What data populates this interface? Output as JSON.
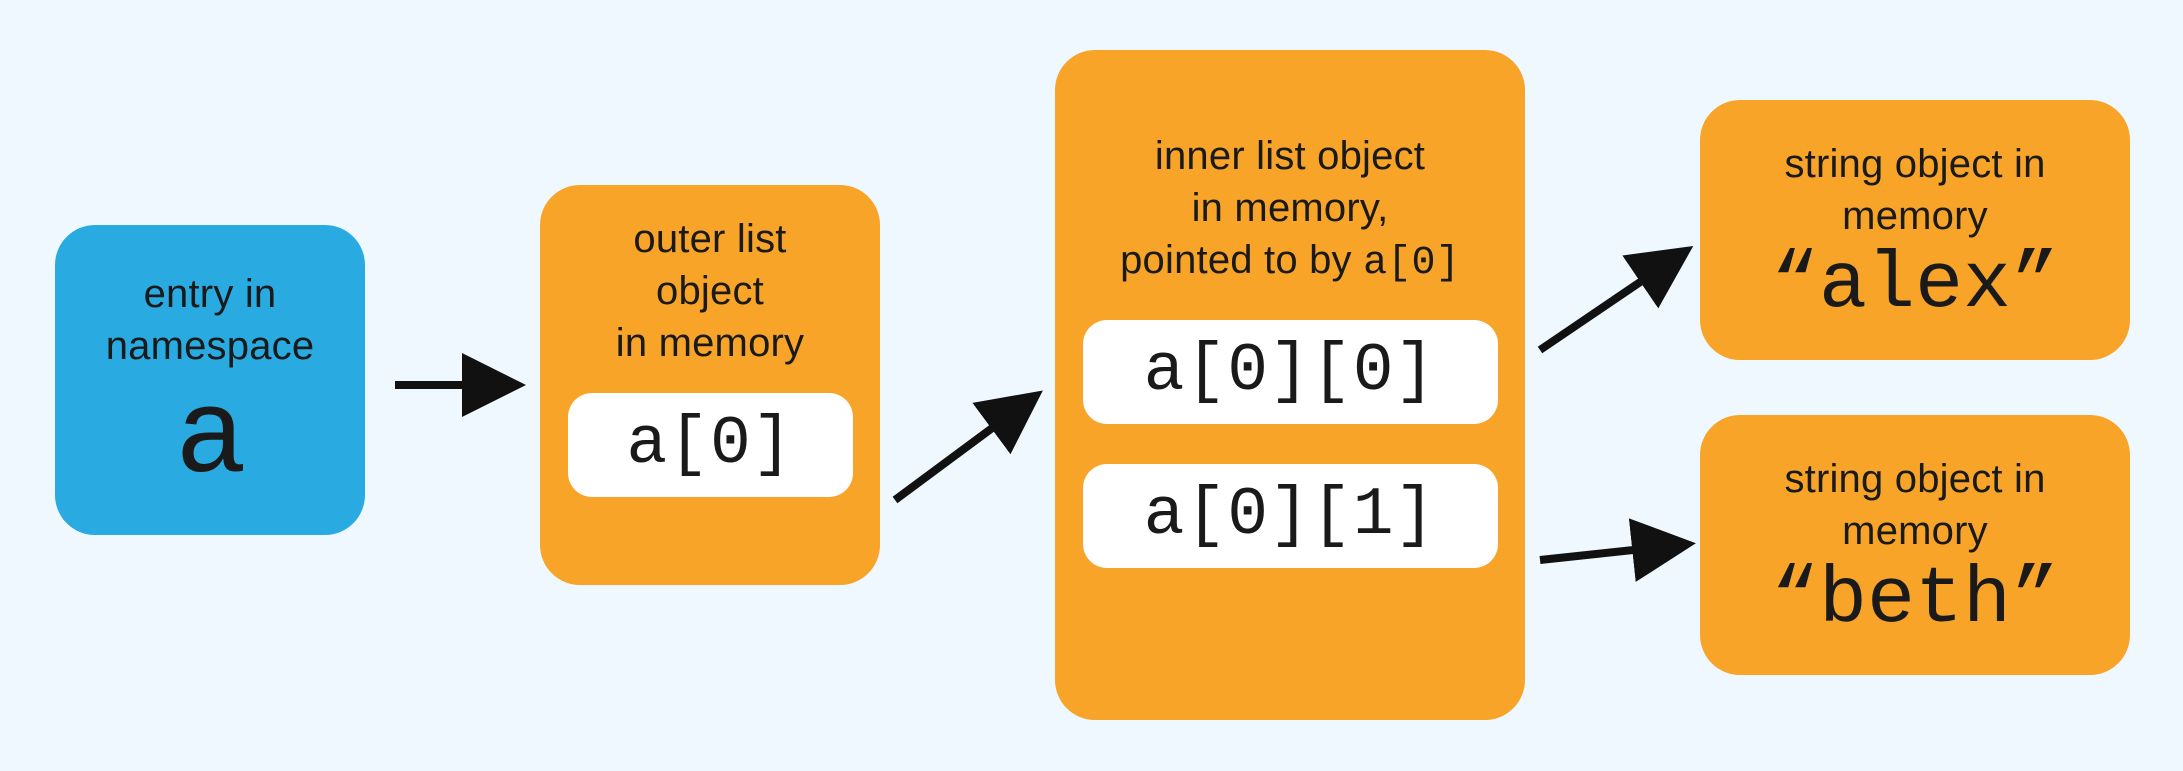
{
  "namespace": {
    "label": "entry in\nnamespace",
    "var": "a"
  },
  "outerList": {
    "label": "outer list\nobject\nin memory",
    "slot0": "a[0]"
  },
  "innerList": {
    "label_pre": "inner list object\nin memory,\npointed to by ",
    "label_code": "a[0]",
    "slot0": "a[0][0]",
    "slot1": "a[0][1]"
  },
  "string0": {
    "label": "string object in\nmemory",
    "value": "“alex”"
  },
  "string1": {
    "label": "string object in\nmemory",
    "value": "“beth”"
  }
}
